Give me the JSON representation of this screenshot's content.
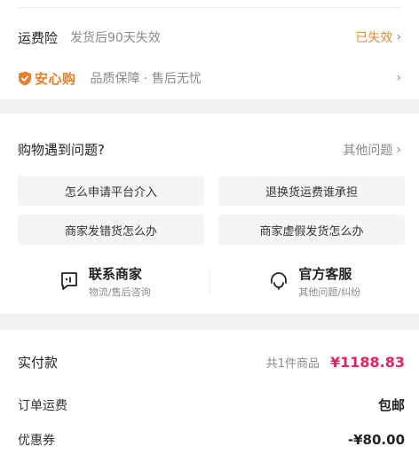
{
  "insurance": {
    "label": "运费险",
    "subtitle": "发货后90天失效",
    "status": "已失效",
    "chevron": "›"
  },
  "assurance": {
    "brand": "安心购",
    "subtitle": "品质保障 · 售后无忧",
    "chevron": "›",
    "icon": "shield-icon",
    "color": "#e8802c"
  },
  "help": {
    "title": "购物遇到问题?",
    "other_label": "其他问题",
    "chevron": "›",
    "questions": [
      "怎么申请平台介入",
      "退换货运费谁承担",
      "商家发错货怎么办",
      "商家虚假发货怎么办"
    ],
    "contacts": [
      {
        "title": "联系商家",
        "subtitle": "物流/售后咨询",
        "icon": "chat-icon"
      },
      {
        "title": "官方客服",
        "subtitle": "其他问题/纠纷",
        "icon": "headset-icon"
      }
    ]
  },
  "payment": {
    "label": "实付款",
    "count": "共1件商品",
    "total": "¥1188.83",
    "total_color": "#e0245e",
    "rows": [
      {
        "label": "订单运费",
        "value": "包邮"
      },
      {
        "label": "优惠券",
        "value": "-¥80.00"
      }
    ]
  }
}
